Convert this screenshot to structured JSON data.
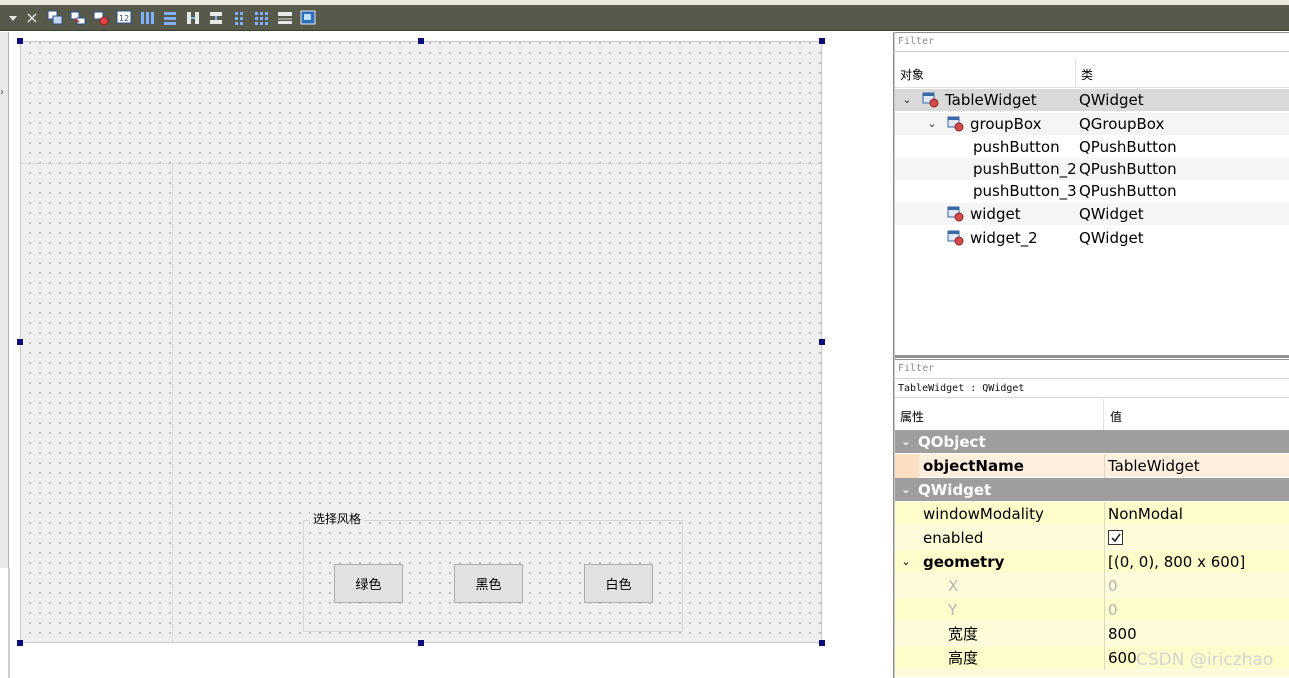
{
  "toolbar": {
    "buttons": [
      {
        "icon": "dropdown-arrow-icon"
      },
      {
        "icon": "close-x-icon"
      },
      {
        "icon": "edit-widgets-icon"
      },
      {
        "icon": "edit-signals-slots-icon"
      },
      {
        "icon": "edit-buddies-icon"
      },
      {
        "icon": "edit-tab-order-icon"
      },
      {
        "icon": "layout-horizontal-icon"
      },
      {
        "icon": "layout-vertical-icon"
      },
      {
        "icon": "layout-horizontal-splitter-icon"
      },
      {
        "icon": "layout-vertical-splitter-icon"
      },
      {
        "icon": "layout-grid-icon"
      },
      {
        "icon": "layout-form-icon"
      },
      {
        "icon": "break-layout-icon"
      },
      {
        "icon": "adjust-size-icon"
      }
    ]
  },
  "form": {
    "groupbox_title": "选择风格",
    "buttons": [
      "绿色",
      "黑色",
      "白色"
    ]
  },
  "object_inspector": {
    "filter_placeholder": "Filter",
    "col_object": "对象",
    "col_class": "类",
    "rows": [
      {
        "name": "TableWidget",
        "cls": "QWidget"
      },
      {
        "name": "groupBox",
        "cls": "QGroupBox"
      },
      {
        "name": "pushButton",
        "cls": "QPushButton"
      },
      {
        "name": "pushButton_2",
        "cls": "QPushButton"
      },
      {
        "name": "pushButton_3",
        "cls": "QPushButton"
      },
      {
        "name": "widget",
        "cls": "QWidget"
      },
      {
        "name": "widget_2",
        "cls": "QWidget"
      }
    ]
  },
  "property_editor": {
    "filter_placeholder": "Filter",
    "caption": "TableWidget : QWidget",
    "col_property": "属性",
    "col_value": "值",
    "groups": {
      "qobject": "QObject",
      "qwidget": "QWidget"
    },
    "props": {
      "objectName": {
        "name": "objectName",
        "value": "TableWidget"
      },
      "windowModality": {
        "name": "windowModality",
        "value": "NonModal"
      },
      "enabled": {
        "name": "enabled",
        "checked": true
      },
      "geometry": {
        "name": "geometry",
        "value": "[(0, 0), 800 x 600]"
      },
      "x": {
        "name": "X",
        "value": "0"
      },
      "y": {
        "name": "Y",
        "value": "0"
      },
      "width": {
        "name": "宽度",
        "value": "800"
      },
      "height": {
        "name": "高度",
        "value": "600"
      }
    }
  },
  "watermark": "CSDN @iriczhao"
}
